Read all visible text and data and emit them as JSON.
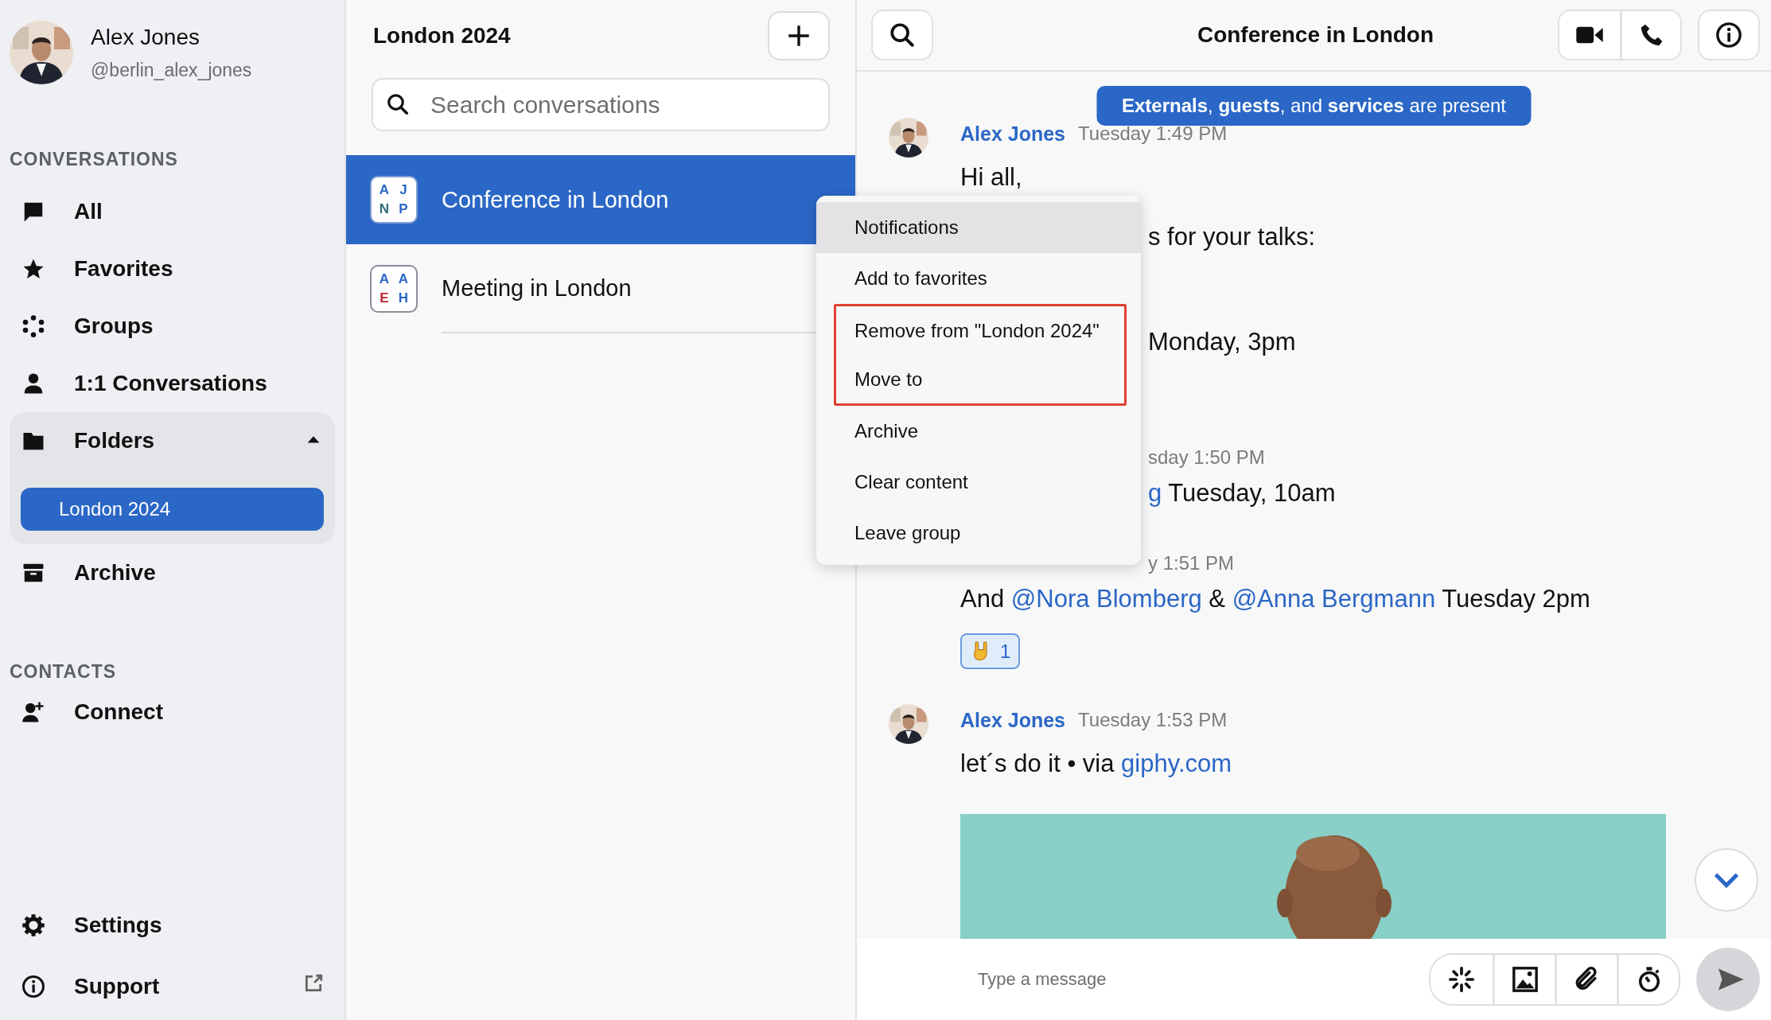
{
  "profile": {
    "name": "Alex Jones",
    "handle": "@berlin_alex_jones"
  },
  "sidebar": {
    "sections": [
      {
        "heading": "CONVERSATIONS",
        "items": [
          {
            "label": "All"
          },
          {
            "label": "Favorites"
          },
          {
            "label": "Groups"
          },
          {
            "label": "1:1 Conversations"
          },
          {
            "label": "Folders",
            "expanded": true,
            "children": [
              {
                "label": "London 2024",
                "selected": true
              }
            ]
          },
          {
            "label": "Archive"
          }
        ]
      },
      {
        "heading": "CONTACTS",
        "items": [
          {
            "label": "Connect"
          }
        ]
      }
    ],
    "footer": [
      {
        "label": "Settings",
        "external": false
      },
      {
        "label": "Support",
        "external": true
      }
    ]
  },
  "conversation_list": {
    "title": "London 2024",
    "search": {
      "placeholder": "Search conversations"
    },
    "items": [
      {
        "name": "Conference in London",
        "selected": true,
        "initials": [
          {
            "letter": "A",
            "color": "#2b67c6"
          },
          {
            "letter": "J",
            "color": "#2b67c6"
          },
          {
            "letter": "N",
            "color": "#2e6b7a"
          },
          {
            "letter": "P",
            "color": "#2b67c6"
          }
        ]
      },
      {
        "name": "Meeting in London",
        "selected": false,
        "initials": [
          {
            "letter": "A",
            "color": "#2b67c6"
          },
          {
            "letter": "A",
            "color": "#2b67c6"
          },
          {
            "letter": "E",
            "color": "#c0262d"
          },
          {
            "letter": "H",
            "color": "#2b67c6"
          }
        ]
      }
    ]
  },
  "chat": {
    "title": "Conference in London",
    "banner": "**Externals**, **guests**, and **services** are present",
    "messages": [
      {
        "author": "Alex Jones",
        "time": "Tuesday 1:49 PM",
        "cut": false,
        "lines": [
          {
            "cut": false,
            "segments": [
              {
                "kind": "plain",
                "text": "Hi all,"
              }
            ]
          },
          {
            "cut": true,
            "segments": [
              {
                "kind": "plain",
                "text": "s for your talks:"
              }
            ]
          },
          {
            "cut": true,
            "segments": [
              {
                "kind": "plain",
                "text": "Monday, 3pm"
              }
            ]
          }
        ]
      },
      {
        "time": "sday 1:50 PM",
        "cut": true,
        "lines": [
          {
            "cut": true,
            "segments": [
              {
                "kind": "mention",
                "text": "g"
              },
              {
                "kind": "plain",
                "text": " Tuesday, 10am"
              }
            ]
          }
        ]
      },
      {
        "time": "y 1:51 PM",
        "cut": true,
        "lines": [
          {
            "cut": false,
            "segments": [
              {
                "kind": "plain",
                "text": "And "
              },
              {
                "kind": "mention",
                "text": "@Nora Blomberg"
              },
              {
                "kind": "plain",
                "text": " & "
              },
              {
                "kind": "mention",
                "text": "@Anna Bergmann"
              },
              {
                "kind": "plain",
                "text": " Tuesday 2pm"
              }
            ]
          }
        ],
        "reactions": [
          {
            "count": "1",
            "selected": true
          }
        ]
      },
      {
        "author": "Alex Jones",
        "time": "Tuesday 1:53 PM",
        "cut": false,
        "lines": [
          {
            "cut": false,
            "segments": [
              {
                "kind": "plain",
                "text": "let´s do it • via "
              },
              {
                "kind": "link",
                "text": "giphy.com"
              }
            ]
          }
        ],
        "attachment": {
          "kind": "picture"
        }
      }
    ],
    "composer": {
      "placeholder": "Type a message"
    }
  },
  "context_menu": {
    "items": [
      {
        "label": "Notifications",
        "highlighted": true,
        "outlined": false
      },
      {
        "label": "Add to favorites",
        "highlighted": false,
        "outlined": false
      },
      {
        "label": "Remove from \"London 2024\"",
        "highlighted": false,
        "outlined": true
      },
      {
        "label": "Move to",
        "highlighted": false,
        "outlined": true
      },
      {
        "label": "Archive",
        "highlighted": false,
        "outlined": false
      },
      {
        "label": "Clear content",
        "highlighted": false,
        "outlined": false
      },
      {
        "label": "Leave group",
        "highlighted": false,
        "outlined": false
      }
    ]
  }
}
